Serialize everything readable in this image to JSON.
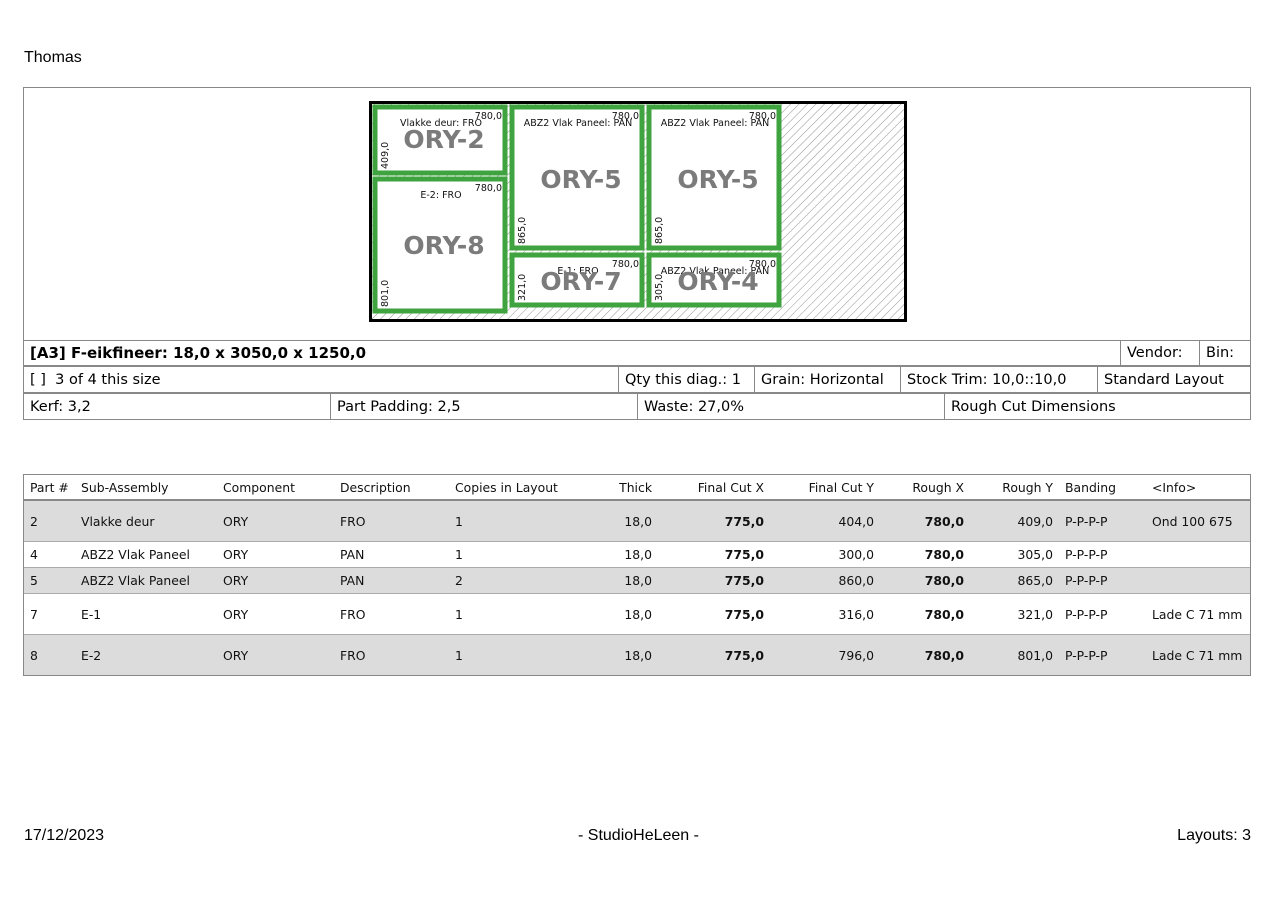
{
  "header": {
    "name": "Thomas"
  },
  "sheet": {
    "title": "[A3] F-eikfineer: 18,0 x 3050,0 x 1250,0",
    "vendor": "Vendor:",
    "bin": "Bin:",
    "checkbox": "[  ]",
    "count": "3 of 4 this size",
    "qty": "Qty this diag.: 1",
    "grain": "Grain: Horizontal",
    "stock_trim": "Stock Trim: 10,0::10,0",
    "layout_type": "Standard Layout",
    "kerf": "Kerf: 3,2",
    "padding": "Part Padding: 2,5",
    "waste": "Waste: 27,0%",
    "rough": "Rough Cut Dimensions"
  },
  "diagram_parts": [
    {
      "id": "p2",
      "label": "Vlakke deur: FRO",
      "big": "ORY-2",
      "w": "780,0",
      "h": "409,0"
    },
    {
      "id": "p8",
      "label": "E-2: FRO",
      "big": "ORY-8",
      "w": "780,0",
      "h": "801,0"
    },
    {
      "id": "p5a",
      "label": "ABZ2 Vlak Paneel: PAN",
      "big": "ORY-5",
      "w": "780,0",
      "h": "865,0"
    },
    {
      "id": "p5b",
      "label": "ABZ2 Vlak Paneel: PAN",
      "big": "ORY-5",
      "w": "780,0",
      "h": "865,0"
    },
    {
      "id": "p7",
      "label": "E-1: FRO",
      "big": "ORY-7",
      "w": "780,0",
      "h": "321,0"
    },
    {
      "id": "p4",
      "label": "ABZ2 Vlak Paneel: PAN",
      "big": "ORY-4",
      "w": "780,0",
      "h": "305,0"
    }
  ],
  "parts_table": {
    "headers": [
      "Part #",
      "Sub-Assembly",
      "Component",
      "Description",
      "Copies in Layout",
      "Thick",
      "Final Cut X",
      "Final Cut Y",
      "Rough X",
      "Rough Y",
      "Banding",
      "<Info>"
    ],
    "rows": [
      [
        "2",
        "Vlakke deur",
        "ORY",
        "FRO",
        "1",
        "18,0",
        "775,0",
        "404,0",
        "780,0",
        "409,0",
        "P-P-P-P",
        "Ond 100 675"
      ],
      [
        "4",
        "ABZ2 Vlak Paneel",
        "ORY",
        "PAN",
        "1",
        "18,0",
        "775,0",
        "300,0",
        "780,0",
        "305,0",
        "P-P-P-P",
        ""
      ],
      [
        "5",
        "ABZ2 Vlak Paneel",
        "ORY",
        "PAN",
        "2",
        "18,0",
        "775,0",
        "860,0",
        "780,0",
        "865,0",
        "P-P-P-P",
        ""
      ],
      [
        "7",
        "E-1",
        "ORY",
        "FRO",
        "1",
        "18,0",
        "775,0",
        "316,0",
        "780,0",
        "321,0",
        "P-P-P-P",
        "Lade C 71 mm"
      ],
      [
        "8",
        "E-2",
        "ORY",
        "FRO",
        "1",
        "18,0",
        "775,0",
        "796,0",
        "780,0",
        "801,0",
        "P-P-P-P",
        "Lade C 71 mm"
      ]
    ]
  },
  "footer": {
    "date": "17/12/2023",
    "studio": "- StudioHeLeen -",
    "layouts": "Layouts: 3"
  },
  "colors": {
    "part_border": "#3fa33f",
    "big_label": "#7b7b7b",
    "row_shade": "#dcdcdc"
  }
}
